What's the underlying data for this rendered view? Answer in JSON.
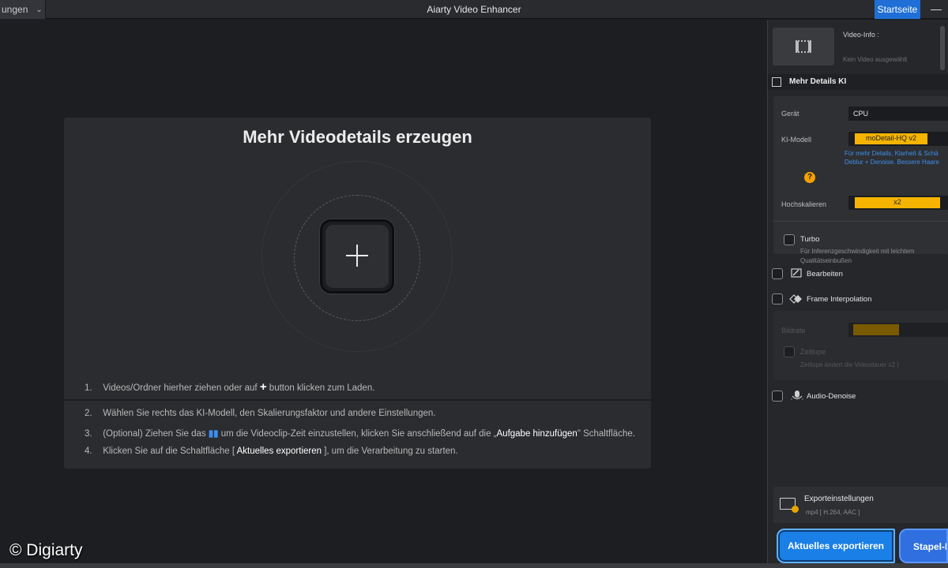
{
  "titlebar": {
    "menu_label": "ungen",
    "title": "Aiarty Video Enhancer",
    "start_button": "Startseite",
    "minimize": "—"
  },
  "main": {
    "heading": "Mehr Videodetails erzeugen",
    "steps": [
      {
        "num": "1.",
        "pre": "Videos/Ordner hierher ziehen oder auf",
        "post": "button klicken zum Laden."
      },
      {
        "num": "2.",
        "text": "Wählen Sie rechts das KI-Modell, den Skalierungsfaktor und andere Einstellungen."
      },
      {
        "num": "3.",
        "pre": "(Optional) Ziehen Sie das",
        "mid": "um die Videoclip-Zeit einzustellen, klicken Sie anschließend auf die „",
        "hl": "Aufgabe hinzufügen",
        "post": "\" Schaltfläche."
      },
      {
        "num": "4.",
        "pre": "Klicken Sie auf die Schaltfläche [",
        "hl": " Aktuelles exportieren ",
        "post": "], um die Verarbeitung zu starten."
      }
    ],
    "copyright": "© Digiarty"
  },
  "panel": {
    "video_info_label": "Video-Info :",
    "video_info_value": "Kein Video ausgewählt",
    "section_title": "Mehr Details KI",
    "device_label": "Gerät",
    "device_value": "CPU",
    "model_label": "KI-Modell",
    "model_value": "moDetail-HQ  v2",
    "model_desc_1": "Für mehr Details, Klarheit & Schä",
    "model_desc_2": "Deblur + Denoise. Bessere Haare",
    "upscale_label": "Hochskalieren",
    "upscale_value": "x2",
    "turbo_label": "Turbo",
    "turbo_desc_1": "Für Inferenzgeschwindigkeit mit leichtem",
    "turbo_desc_2": "Qualitätseinbußen",
    "edit_label": "Bearbeiten",
    "frame_interp_label": "Frame Interpolation",
    "framerate_label": "Bildrate",
    "slowmo_label": "Zeitlupe",
    "slowmo_desc": "Zeitlupe ändert die Videodauer x2 )",
    "audio_denoise_label": "Audio-Denoise",
    "export_settings_title": "Exporteinstellungen",
    "export_settings_sub": "mp4 [ H.264, AAC ]",
    "export_button": "Aktuelles exportieren",
    "batch_button": "Stapel-E"
  },
  "colors": {
    "accent_blue": "#1f6fd6",
    "accent_yellow": "#f5b400",
    "link_blue": "#3d8fe8"
  }
}
